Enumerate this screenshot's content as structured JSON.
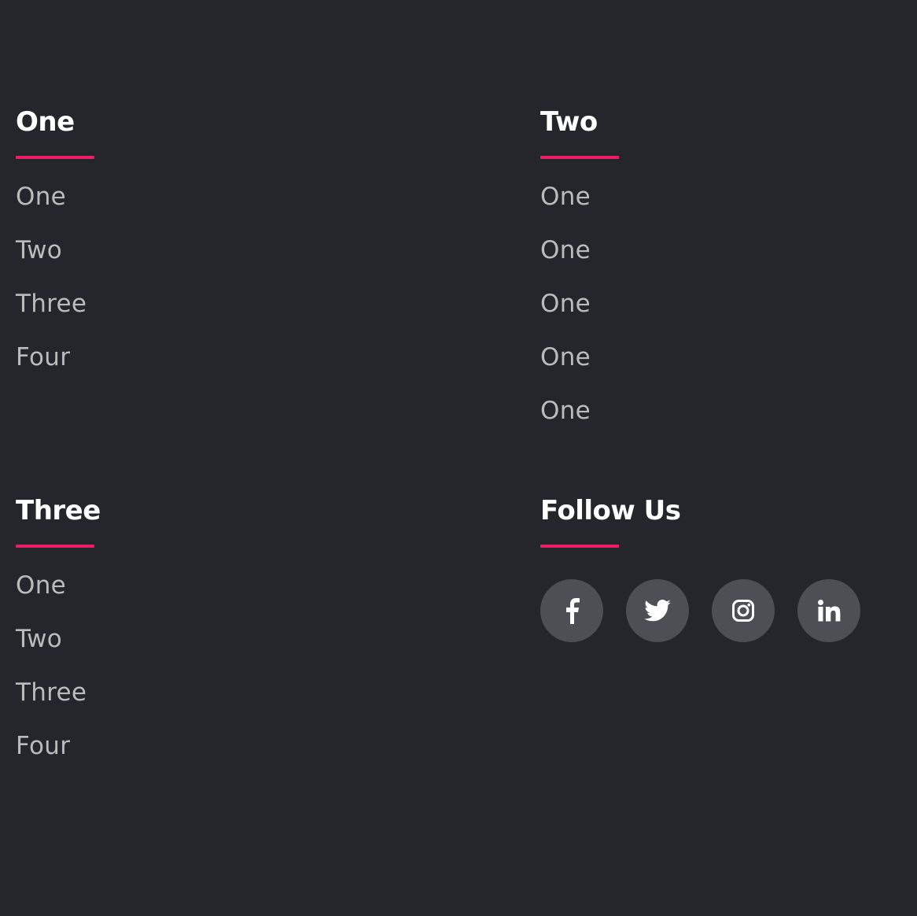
{
  "columns": [
    {
      "title": "One",
      "links": [
        "One",
        "Two",
        "Three",
        "Four"
      ]
    },
    {
      "title": "Two",
      "links": [
        "One",
        "One",
        "One",
        "One",
        "One"
      ]
    },
    {
      "title": "Three",
      "links": [
        "One",
        "Two",
        "Three",
        "Four"
      ]
    }
  ],
  "follow": {
    "title": "Follow Us",
    "icons": [
      "facebook-icon",
      "twitter-icon",
      "instagram-icon",
      "linkedin-icon"
    ]
  },
  "colors": {
    "background": "#24262b",
    "accent": "#e91e63",
    "heading": "#ffffff",
    "link": "#bbbbbb",
    "social_bg": "#4d4f54"
  }
}
